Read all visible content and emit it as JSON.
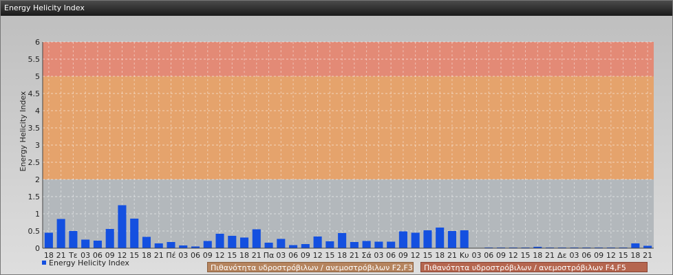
{
  "window": {
    "title": "Energy Helicity Index"
  },
  "legend": {
    "series_label": "Energy Helicity Index",
    "f2f3_label": "Πιθανότητα υδροστρόβιλων / ανεμοστρόβιλων F2,F3",
    "f4f5_label": "Πιθανότητα υδροστρόβιλων / ανεμοστρόβιλων F4,F5"
  },
  "colors": {
    "bar": "#1450e0",
    "band_low": "#b3b8bc",
    "band_mid": "#e5a36c",
    "band_high": "#e38a76"
  },
  "chart_data": {
    "type": "bar",
    "ylabel": "Energy Helicity Index",
    "ylim": [
      0,
      6
    ],
    "yticks": [
      "0",
      "0.5",
      "1",
      "1.5",
      "2",
      "2.5",
      "3",
      "3.5",
      "4",
      "4.5",
      "5",
      "5.5",
      "6"
    ],
    "bands": [
      {
        "from": 0,
        "to": 2,
        "color": "#b3b8bc"
      },
      {
        "from": 2,
        "to": 5,
        "color": "#e5a36c"
      },
      {
        "from": 5,
        "to": 6,
        "color": "#e38a76"
      }
    ],
    "categories": [
      "18",
      "21",
      "Τε",
      "03",
      "06",
      "09",
      "12",
      "15",
      "18",
      "21",
      "Πέ",
      "03",
      "06",
      "09",
      "12",
      "15",
      "18",
      "21",
      "Πα",
      "03",
      "06",
      "09",
      "12",
      "15",
      "18",
      "21",
      "Σά",
      "03",
      "06",
      "09",
      "12",
      "15",
      "18",
      "21",
      "Κυ",
      "03",
      "06",
      "09",
      "12",
      "15",
      "18",
      "21",
      "Δε",
      "03",
      "06",
      "09",
      "12",
      "15",
      "18",
      "21"
    ],
    "series": [
      {
        "name": "Energy Helicity Index",
        "values": [
          0.45,
          0.85,
          0.5,
          0.25,
          0.22,
          0.56,
          1.25,
          0.86,
          0.33,
          0.14,
          0.18,
          0.08,
          0.05,
          0.21,
          0.42,
          0.36,
          0.31,
          0.55,
          0.16,
          0.27,
          0.09,
          0.12,
          0.34,
          0.2,
          0.44,
          0.18,
          0.21,
          0.19,
          0.19,
          0.49,
          0.45,
          0.52,
          0.6,
          0.5,
          0.52,
          0.01,
          0.02,
          0.02,
          0.02,
          0.02,
          0.04,
          0.02,
          0.02,
          0.02,
          0.02,
          0.02,
          0.02,
          0.02,
          0.14,
          0.07
        ]
      }
    ],
    "grid": true
  }
}
